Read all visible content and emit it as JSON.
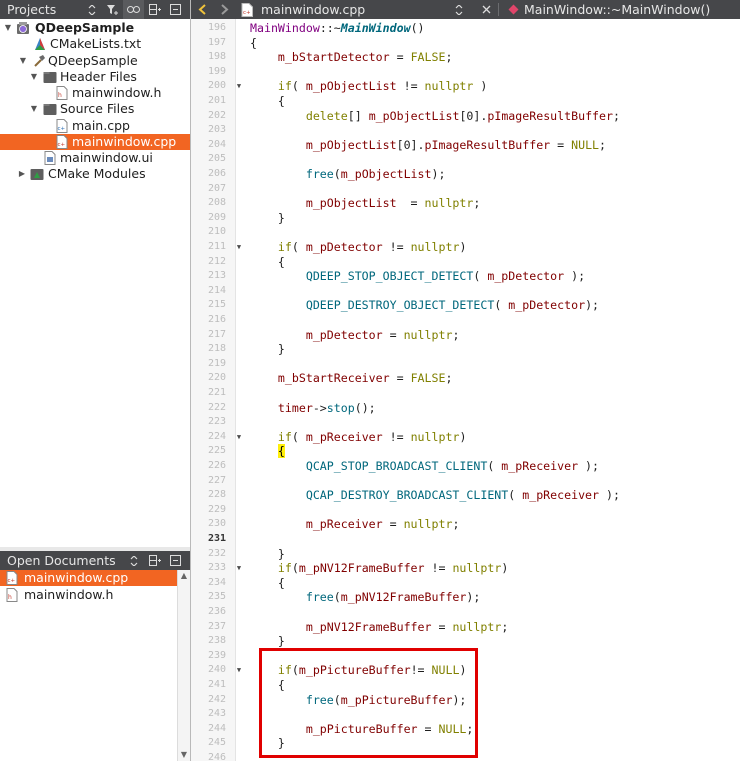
{
  "projects_panel": {
    "title": "Projects",
    "tree": [
      {
        "label": "QDeepSample",
        "bold": true,
        "indent": 0,
        "expanded": true,
        "icon": "project-icon"
      },
      {
        "label": "CMakeLists.txt",
        "indent": 1,
        "icon": "cmake-file-icon"
      },
      {
        "label": "QDeepSample",
        "indent": 1,
        "expanded": true,
        "icon": "build-hammer-icon"
      },
      {
        "label": "Header Files",
        "indent": 2,
        "expanded": true,
        "icon": "folder-icon"
      },
      {
        "label": "mainwindow.h",
        "indent": 3,
        "icon": "header-file-icon"
      },
      {
        "label": "Source Files",
        "indent": 2,
        "expanded": true,
        "icon": "folder-icon"
      },
      {
        "label": "main.cpp",
        "indent": 3,
        "icon": "cpp-file-icon"
      },
      {
        "label": "mainwindow.cpp",
        "indent": 3,
        "selected": true,
        "icon": "cpp-file-icon"
      },
      {
        "label": "mainwindow.ui",
        "indent": 2,
        "icon": "ui-file-icon"
      },
      {
        "label": "CMake Modules",
        "indent": 1,
        "expanded": false,
        "icon": "cmake-folder-icon"
      }
    ]
  },
  "open_documents": {
    "title": "Open Documents",
    "items": [
      {
        "label": "mainwindow.cpp",
        "selected": true
      },
      {
        "label": "mainwindow.h",
        "selected": false
      }
    ]
  },
  "editor": {
    "file_tab": "mainwindow.cpp",
    "symbol": "MainWindow::~MainWindow()",
    "current_line": 231,
    "lines": [
      {
        "n": "196",
        "t": "MainWindow::~MainWindow()",
        "fold": false
      },
      {
        "n": "197",
        "t": "{",
        "fold": false
      },
      {
        "n": "198",
        "t": "    m_bStartDetector = FALSE;",
        "fold": false
      },
      {
        "n": "199",
        "t": "",
        "fold": false
      },
      {
        "n": "200",
        "t": "    if( m_pObjectList != nullptr )",
        "fold": true
      },
      {
        "n": "201",
        "t": "    {",
        "fold": false
      },
      {
        "n": "202",
        "t": "        delete[] m_pObjectList[0].pImageResultBuffer;",
        "fold": false
      },
      {
        "n": "203",
        "t": "",
        "fold": false
      },
      {
        "n": "204",
        "t": "        m_pObjectList[0].pImageResultBuffer = NULL;",
        "fold": false
      },
      {
        "n": "205",
        "t": "",
        "fold": false
      },
      {
        "n": "206",
        "t": "        free(m_pObjectList);",
        "fold": false
      },
      {
        "n": "207",
        "t": "",
        "fold": false
      },
      {
        "n": "208",
        "t": "        m_pObjectList  = nullptr;",
        "fold": false
      },
      {
        "n": "209",
        "t": "    }",
        "fold": false
      },
      {
        "n": "210",
        "t": "",
        "fold": false
      },
      {
        "n": "211",
        "t": "    if( m_pDetector != nullptr)",
        "fold": true
      },
      {
        "n": "212",
        "t": "    {",
        "fold": false
      },
      {
        "n": "213",
        "t": "        QDEEP_STOP_OBJECT_DETECT( m_pDetector );",
        "fold": false
      },
      {
        "n": "214",
        "t": "",
        "fold": false
      },
      {
        "n": "215",
        "t": "        QDEEP_DESTROY_OBJECT_DETECT( m_pDetector);",
        "fold": false
      },
      {
        "n": "216",
        "t": "",
        "fold": false
      },
      {
        "n": "217",
        "t": "        m_pDetector = nullptr;",
        "fold": false
      },
      {
        "n": "218",
        "t": "    }",
        "fold": false
      },
      {
        "n": "219",
        "t": "",
        "fold": false
      },
      {
        "n": "220",
        "t": "    m_bStartReceiver = FALSE;",
        "fold": false
      },
      {
        "n": "221",
        "t": "",
        "fold": false
      },
      {
        "n": "222",
        "t": "    timer->stop();",
        "fold": false
      },
      {
        "n": "223",
        "t": "",
        "fold": false
      },
      {
        "n": "224",
        "t": "    if( m_pReceiver != nullptr)",
        "fold": true
      },
      {
        "n": "225",
        "t": "    {",
        "fold": false
      },
      {
        "n": "226",
        "t": "        QCAP_STOP_BROADCAST_CLIENT( m_pReceiver );",
        "fold": false
      },
      {
        "n": "227",
        "t": "",
        "fold": false
      },
      {
        "n": "228",
        "t": "        QCAP_DESTROY_BROADCAST_CLIENT( m_pReceiver );",
        "fold": false
      },
      {
        "n": "229",
        "t": "",
        "fold": false
      },
      {
        "n": "230",
        "t": "        m_pReceiver = nullptr;",
        "fold": false
      },
      {
        "n": "231",
        "t": "",
        "fold": false
      },
      {
        "n": "232",
        "t": "    }",
        "fold": false
      },
      {
        "n": "233",
        "t": "    if(m_pNV12FrameBuffer != nullptr)",
        "fold": true
      },
      {
        "n": "234",
        "t": "    {",
        "fold": false
      },
      {
        "n": "235",
        "t": "        free(m_pNV12FrameBuffer);",
        "fold": false
      },
      {
        "n": "236",
        "t": "",
        "fold": false
      },
      {
        "n": "237",
        "t": "        m_pNV12FrameBuffer = nullptr;",
        "fold": false
      },
      {
        "n": "238",
        "t": "    }",
        "fold": false
      },
      {
        "n": "239",
        "t": "",
        "fold": false
      },
      {
        "n": "240",
        "t": "    if(m_pPictureBuffer!= NULL)",
        "fold": true
      },
      {
        "n": "241",
        "t": "    {",
        "fold": false
      },
      {
        "n": "242",
        "t": "        free(m_pPictureBuffer);",
        "fold": false
      },
      {
        "n": "243",
        "t": "",
        "fold": false
      },
      {
        "n": "244",
        "t": "        m_pPictureBuffer = NULL;",
        "fold": false
      },
      {
        "n": "245",
        "t": "    }",
        "fold": false
      },
      {
        "n": "246",
        "t": "",
        "fold": false
      }
    ]
  },
  "colors": {
    "selection": "#f26522",
    "panel_header": "#46474a",
    "keyword": "#808000",
    "function": "#00677c",
    "member": "#800000",
    "annotation_box": "#e00000"
  }
}
